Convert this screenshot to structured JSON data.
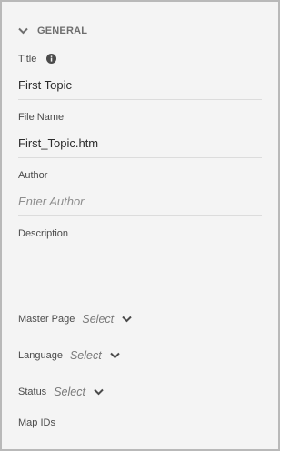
{
  "section": {
    "title": "GENERAL",
    "expanded": true
  },
  "fields": {
    "title": {
      "label": "Title",
      "value": "First Topic"
    },
    "file_name": {
      "label": "File Name",
      "value": "First_Topic.htm"
    },
    "author": {
      "label": "Author",
      "placeholder": "Enter Author"
    },
    "description": {
      "label": "Description",
      "value": ""
    }
  },
  "selects": {
    "master_page": {
      "label": "Master Page",
      "value": "Select"
    },
    "language": {
      "label": "Language",
      "value": "Select"
    },
    "status": {
      "label": "Status",
      "value": "Select"
    }
  },
  "map_ids": {
    "label": "Map IDs"
  },
  "icons": {
    "collapse": "chevron-down-icon",
    "info": "info-icon",
    "dropdown": "chevron-down-icon"
  },
  "colors": {
    "panel_bg": "#f4f4f4",
    "panel_border": "#b9b9b9",
    "label": "#4b4b4b",
    "value": "#2c2c2c",
    "placeholder": "#8e8e8e",
    "divider": "#dcdcdc"
  }
}
